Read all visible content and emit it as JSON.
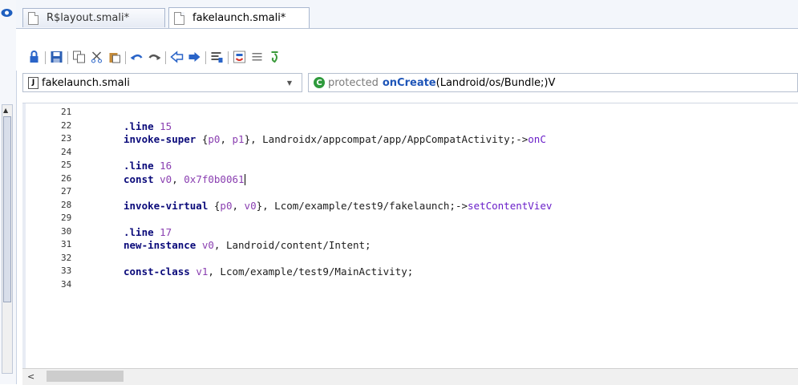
{
  "tabs": [
    {
      "label": "R$layout.smali*",
      "active": false
    },
    {
      "label": "fakelaunch.smali*",
      "active": true
    }
  ],
  "file_selector": {
    "value": "fakelaunch.smali"
  },
  "method_selector": {
    "modifier": "protected",
    "name": "onCreate",
    "signature": "(Landroid/os/Bundle;)V"
  },
  "lines": [
    {
      "n": "21",
      "parts": []
    },
    {
      "n": "22",
      "parts": [
        {
          "t": ".line ",
          "c": "dir"
        },
        {
          "t": "15",
          "c": "num"
        }
      ]
    },
    {
      "n": "23",
      "parts": [
        {
          "t": "invoke-super ",
          "c": "kw"
        },
        {
          "t": "{",
          "c": "txt"
        },
        {
          "t": "p0",
          "c": "reg"
        },
        {
          "t": ", ",
          "c": "txt"
        },
        {
          "t": "p1",
          "c": "reg"
        },
        {
          "t": "}, Landroidx/appcompat/app/AppCompatActivity;->",
          "c": "txt"
        },
        {
          "t": "onC",
          "c": "m"
        }
      ]
    },
    {
      "n": "24",
      "parts": []
    },
    {
      "n": "25",
      "parts": [
        {
          "t": ".line ",
          "c": "dir"
        },
        {
          "t": "16",
          "c": "num"
        }
      ]
    },
    {
      "n": "26",
      "parts": [
        {
          "t": "const ",
          "c": "kw"
        },
        {
          "t": "v0",
          "c": "reg"
        },
        {
          "t": ", ",
          "c": "txt"
        },
        {
          "t": "0x7f0b0061",
          "c": "num"
        }
      ],
      "cursor": true
    },
    {
      "n": "27",
      "parts": []
    },
    {
      "n": "28",
      "parts": [
        {
          "t": "invoke-virtual ",
          "c": "kw"
        },
        {
          "t": "{",
          "c": "txt"
        },
        {
          "t": "p0",
          "c": "reg"
        },
        {
          "t": ", ",
          "c": "txt"
        },
        {
          "t": "v0",
          "c": "reg"
        },
        {
          "t": "}, Lcom/example/test9/fakelaunch;->",
          "c": "txt"
        },
        {
          "t": "setContentViev",
          "c": "m"
        }
      ]
    },
    {
      "n": "29",
      "parts": []
    },
    {
      "n": "30",
      "parts": [
        {
          "t": ".line ",
          "c": "dir"
        },
        {
          "t": "17",
          "c": "num"
        }
      ]
    },
    {
      "n": "31",
      "parts": [
        {
          "t": "new-instance ",
          "c": "kw"
        },
        {
          "t": "v0",
          "c": "reg"
        },
        {
          "t": ", Landroid/content/Intent;",
          "c": "txt"
        }
      ]
    },
    {
      "n": "32",
      "parts": []
    },
    {
      "n": "33",
      "parts": [
        {
          "t": "const-class ",
          "c": "kw"
        },
        {
          "t": "v1",
          "c": "reg"
        },
        {
          "t": ", Lcom/example/test9/MainActivity;",
          "c": "txt"
        }
      ]
    },
    {
      "n": "34",
      "parts": []
    }
  ],
  "icons": [
    "eye-icon",
    "lock-icon",
    "save-icon",
    "copy-icon",
    "cut-icon",
    "paste-icon",
    "undo-icon",
    "redo-icon",
    "back-icon",
    "forward-icon",
    "format-icon",
    "java-icon",
    "list-icon",
    "step-icon"
  ],
  "colors": {
    "keyword": "#0a0a7a",
    "register": "#8a3fb1",
    "method": "#6a1fc9",
    "green": "#2e9a3c",
    "method_name": "#1e55b8"
  }
}
